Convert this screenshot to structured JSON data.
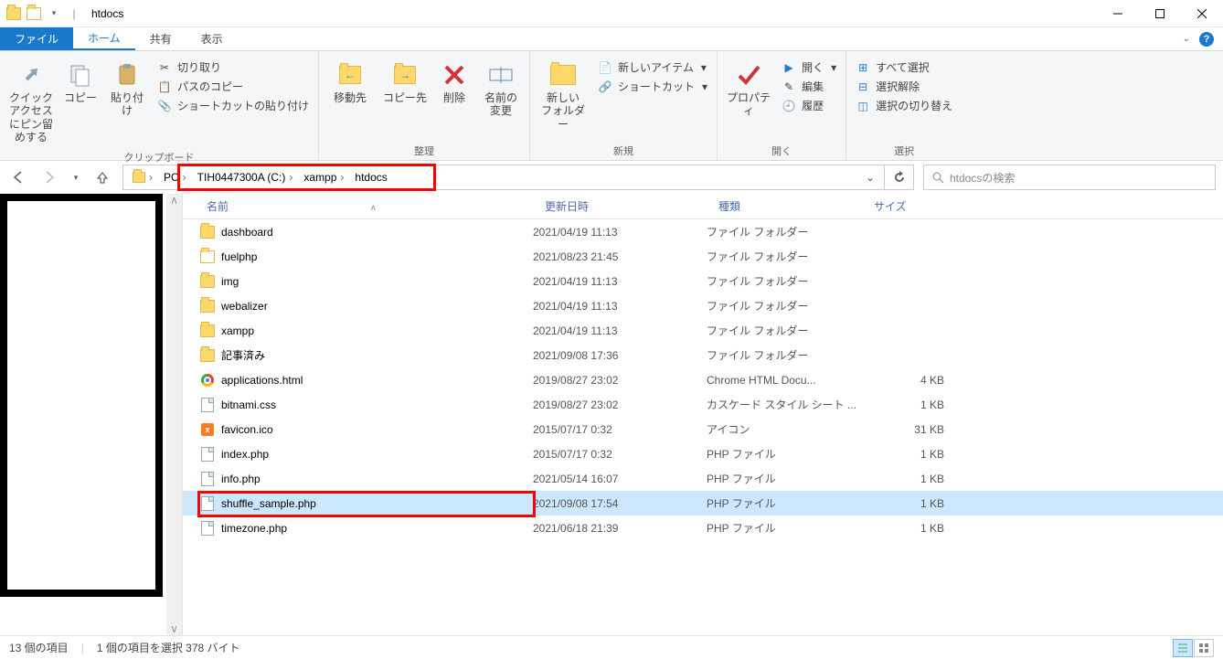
{
  "window": {
    "title": "htdocs",
    "separator": "|"
  },
  "tabs": {
    "file": "ファイル",
    "home": "ホーム",
    "share": "共有",
    "view": "表示"
  },
  "ribbon": {
    "clipboard": {
      "quick_access": "クイック アクセス\nにピン留めする",
      "copy": "コピー",
      "paste": "貼り付け",
      "cut": "切り取り",
      "copy_path": "パスのコピー",
      "paste_shortcut": "ショートカットの貼り付け",
      "group": "クリップボード"
    },
    "organize": {
      "move_to": "移動先",
      "copy_to": "コピー先",
      "delete": "削除",
      "rename": "名前の\n変更",
      "group": "整理"
    },
    "new": {
      "new_folder": "新しい\nフォルダー",
      "new_item": "新しいアイテム",
      "shortcut": "ショートカット",
      "group": "新規"
    },
    "open": {
      "properties": "プロパティ",
      "open": "開く",
      "edit": "編集",
      "history": "履歴",
      "group": "開く"
    },
    "select": {
      "select_all": "すべて選択",
      "deselect": "選択解除",
      "invert": "選択の切り替え",
      "group": "選択"
    }
  },
  "nav": {
    "pc": "PC",
    "drive": "TIH0447300A (C:)",
    "xampp": "xampp",
    "htdocs": "htdocs",
    "search_placeholder": "htdocsの検索"
  },
  "columns": {
    "name": "名前",
    "date": "更新日時",
    "type": "種類",
    "size": "サイズ"
  },
  "rows": [
    {
      "name": "dashboard",
      "date": "2021/04/19 11:13",
      "type": "ファイル フォルダー",
      "size": "",
      "icon": "folder"
    },
    {
      "name": "fuelphp",
      "date": "2021/08/23 21:45",
      "type": "ファイル フォルダー",
      "size": "",
      "icon": "folder-exe"
    },
    {
      "name": "img",
      "date": "2021/04/19 11:13",
      "type": "ファイル フォルダー",
      "size": "",
      "icon": "folder"
    },
    {
      "name": "webalizer",
      "date": "2021/04/19 11:13",
      "type": "ファイル フォルダー",
      "size": "",
      "icon": "folder"
    },
    {
      "name": "xampp",
      "date": "2021/04/19 11:13",
      "type": "ファイル フォルダー",
      "size": "",
      "icon": "folder"
    },
    {
      "name": "記事済み",
      "date": "2021/09/08 17:36",
      "type": "ファイル フォルダー",
      "size": "",
      "icon": "folder"
    },
    {
      "name": "applications.html",
      "date": "2019/08/27 23:02",
      "type": "Chrome HTML Docu...",
      "size": "4 KB",
      "icon": "chrome"
    },
    {
      "name": "bitnami.css",
      "date": "2019/08/27 23:02",
      "type": "カスケード スタイル シート ...",
      "size": "1 KB",
      "icon": "doc"
    },
    {
      "name": "favicon.ico",
      "date": "2015/07/17 0:32",
      "type": "アイコン",
      "size": "31 KB",
      "icon": "xampp"
    },
    {
      "name": "index.php",
      "date": "2015/07/17 0:32",
      "type": "PHP ファイル",
      "size": "1 KB",
      "icon": "doc"
    },
    {
      "name": "info.php",
      "date": "2021/05/14 16:07",
      "type": "PHP ファイル",
      "size": "1 KB",
      "icon": "doc"
    },
    {
      "name": "shuffle_sample.php",
      "date": "2021/09/08 17:54",
      "type": "PHP ファイル",
      "size": "1 KB",
      "icon": "doc",
      "selected": true
    },
    {
      "name": "timezone.php",
      "date": "2021/06/18 21:39",
      "type": "PHP ファイル",
      "size": "1 KB",
      "icon": "doc"
    }
  ],
  "status": {
    "count": "13 個の項目",
    "selection": "1 個の項目を選択 378 バイト"
  }
}
